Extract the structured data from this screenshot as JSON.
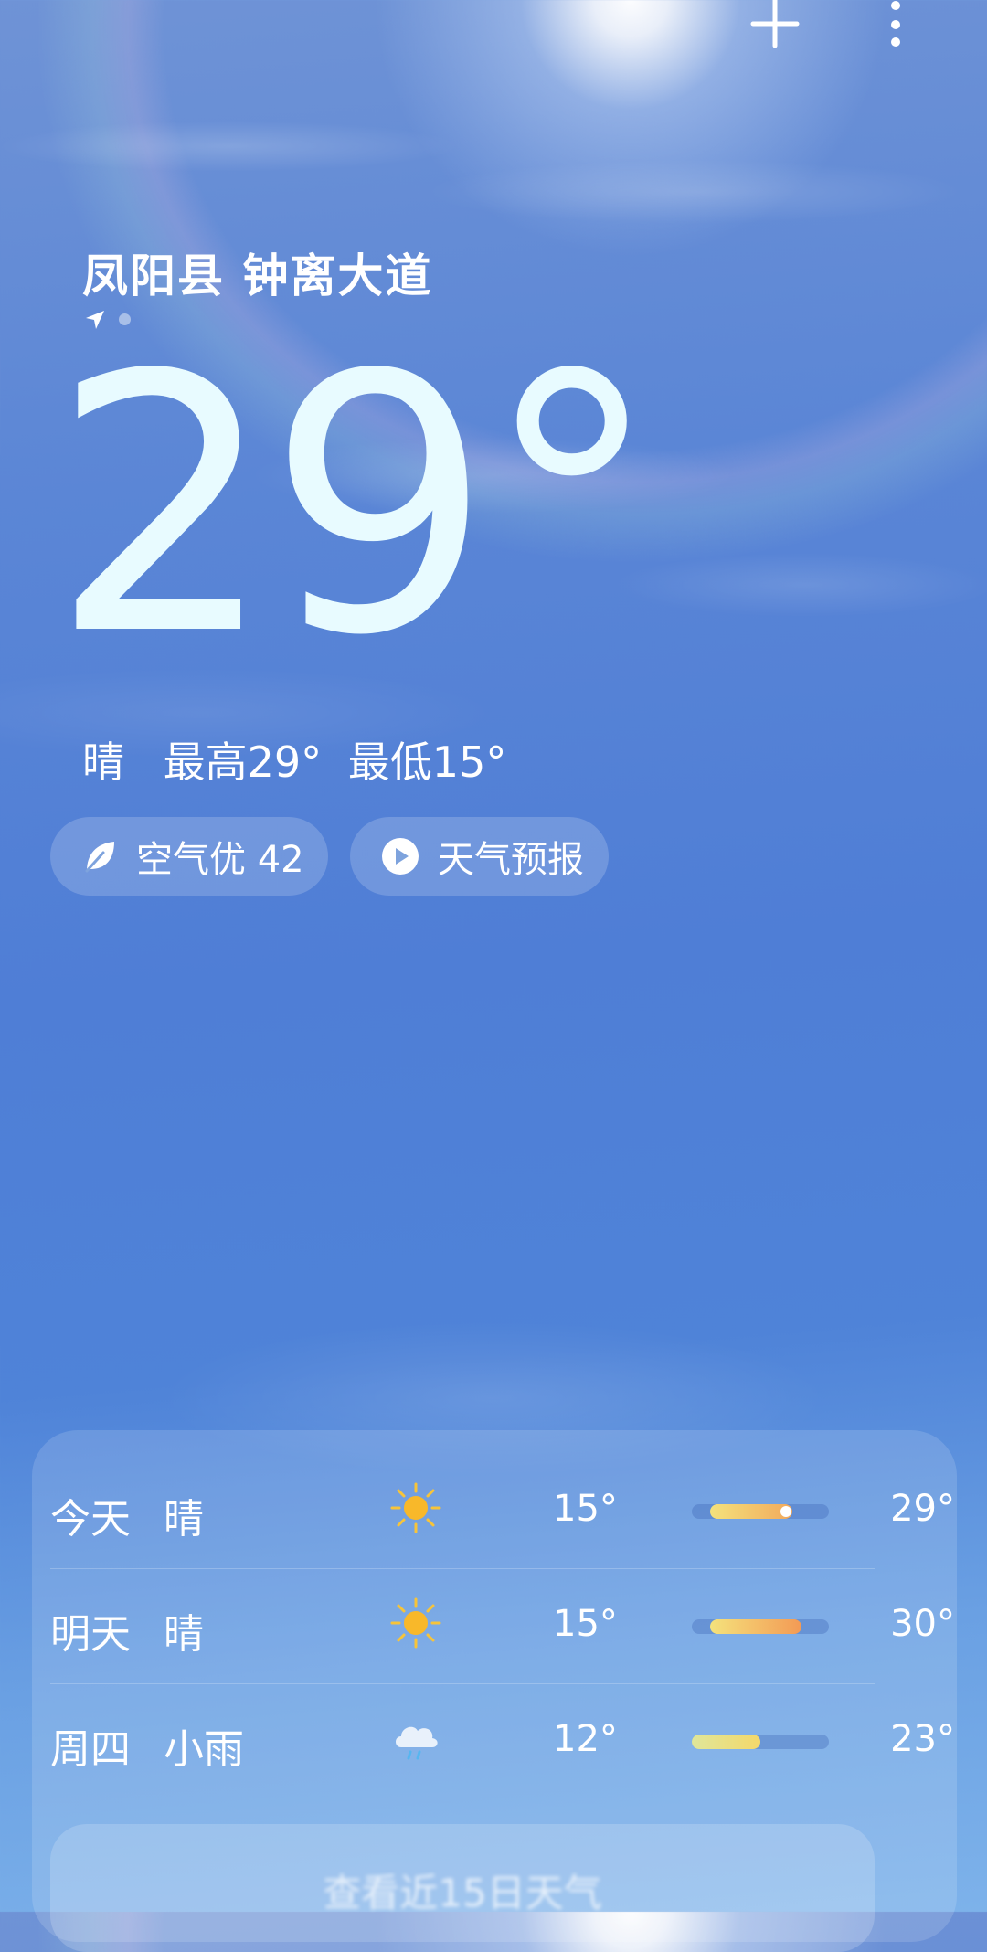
{
  "location": "凤阳县 钟离大道",
  "current": {
    "temperature": "29°",
    "condition": "晴",
    "high": "最高29°",
    "low": "最低15°"
  },
  "chips": {
    "air_quality": "空气优 42",
    "forecast_video": "天气预报"
  },
  "forecast": [
    {
      "day": "今天",
      "condition": "晴",
      "icon": "sun-icon",
      "low": "15°",
      "high": "29°",
      "current_marker": true
    },
    {
      "day": "明天",
      "condition": "晴",
      "icon": "sun-icon",
      "low": "15°",
      "high": "30°"
    },
    {
      "day": "周四",
      "condition": "小雨",
      "icon": "rain-cloud-icon",
      "low": "12°",
      "high": "23°"
    }
  ],
  "detail_button": "查看近15日天气",
  "colors": {
    "sky_top": "#6f93d6",
    "sky_mid": "#4f7ed6",
    "sky_bottom": "#7db2ea",
    "temp_text": "#e8fbff",
    "bar_yellow": "#f3e07a",
    "bar_orange": "#f39a55"
  }
}
